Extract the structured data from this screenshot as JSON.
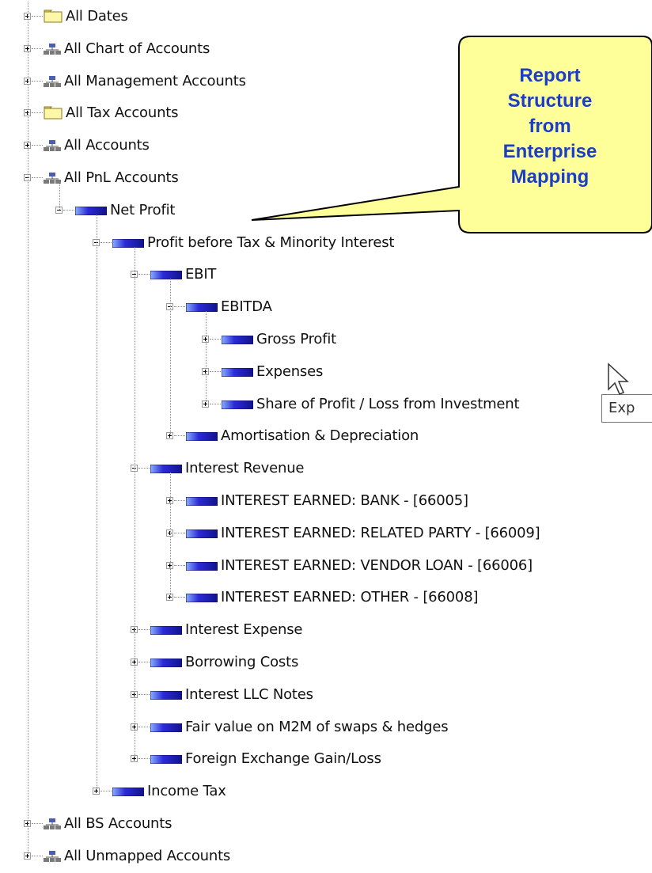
{
  "tree": {
    "nodes": [
      {
        "label": "All Dates",
        "icon": "folder-icon",
        "expanded": false
      },
      {
        "label": "All Chart of Accounts",
        "icon": "hierarchy-icon",
        "expanded": false
      },
      {
        "label": "All Management Accounts",
        "icon": "hierarchy-icon",
        "expanded": false
      },
      {
        "label": "All Tax Accounts",
        "icon": "folder-icon",
        "expanded": false
      },
      {
        "label": "All Accounts",
        "icon": "hierarchy-icon",
        "expanded": false
      },
      {
        "label": "All PnL Accounts",
        "icon": "hierarchy-icon",
        "expanded": true
      },
      {
        "label": "Net Profit",
        "icon": "member-icon",
        "expanded": true
      },
      {
        "label": "Profit before Tax & Minority Interest",
        "icon": "member-icon",
        "expanded": true
      },
      {
        "label": "EBIT",
        "icon": "member-icon",
        "expanded": true
      },
      {
        "label": "EBITDA",
        "icon": "member-icon",
        "expanded": true
      },
      {
        "label": "Gross Profit",
        "icon": "member-icon",
        "expanded": false
      },
      {
        "label": "Expenses",
        "icon": "member-icon",
        "expanded": false
      },
      {
        "label": "Share of Profit / Loss from Investment",
        "icon": "member-icon",
        "expanded": false
      },
      {
        "label": "Amortisation & Depreciation",
        "icon": "member-icon",
        "expanded": false
      },
      {
        "label": "Interest Revenue",
        "icon": "member-icon",
        "expanded": true
      },
      {
        "label": "INTEREST EARNED: BANK - [66005]",
        "icon": "member-icon",
        "expanded": false
      },
      {
        "label": "INTEREST EARNED: RELATED PARTY - [66009]",
        "icon": "member-icon",
        "expanded": false
      },
      {
        "label": "INTEREST EARNED: VENDOR LOAN - [66006]",
        "icon": "member-icon",
        "expanded": false
      },
      {
        "label": "INTEREST EARNED: OTHER - [66008]",
        "icon": "member-icon",
        "expanded": false
      },
      {
        "label": "Interest Expense",
        "icon": "member-icon",
        "expanded": false
      },
      {
        "label": "Borrowing Costs",
        "icon": "member-icon",
        "expanded": false
      },
      {
        "label": "Interest LLC Notes",
        "icon": "member-icon",
        "expanded": false
      },
      {
        "label": "Fair value on M2M of swaps & hedges",
        "icon": "member-icon",
        "expanded": false
      },
      {
        "label": "Foreign Exchange Gain/Loss",
        "icon": "member-icon",
        "expanded": false
      },
      {
        "label": "Income Tax",
        "icon": "member-icon",
        "expanded": false
      },
      {
        "label": "All BS Accounts",
        "icon": "hierarchy-icon",
        "expanded": false
      },
      {
        "label": "All Unmapped Accounts",
        "icon": "hierarchy-icon",
        "expanded": false
      }
    ]
  },
  "callout": {
    "line1": "Report",
    "line2": "Structure",
    "line3": "from",
    "line4": "Enterprise",
    "line5": "Mapping"
  },
  "tooltip": {
    "text": "Exp"
  },
  "colors": {
    "callout_fill": "#ffff99",
    "callout_text": "#1a3ec8",
    "member_icon": "#2b2bd8"
  }
}
